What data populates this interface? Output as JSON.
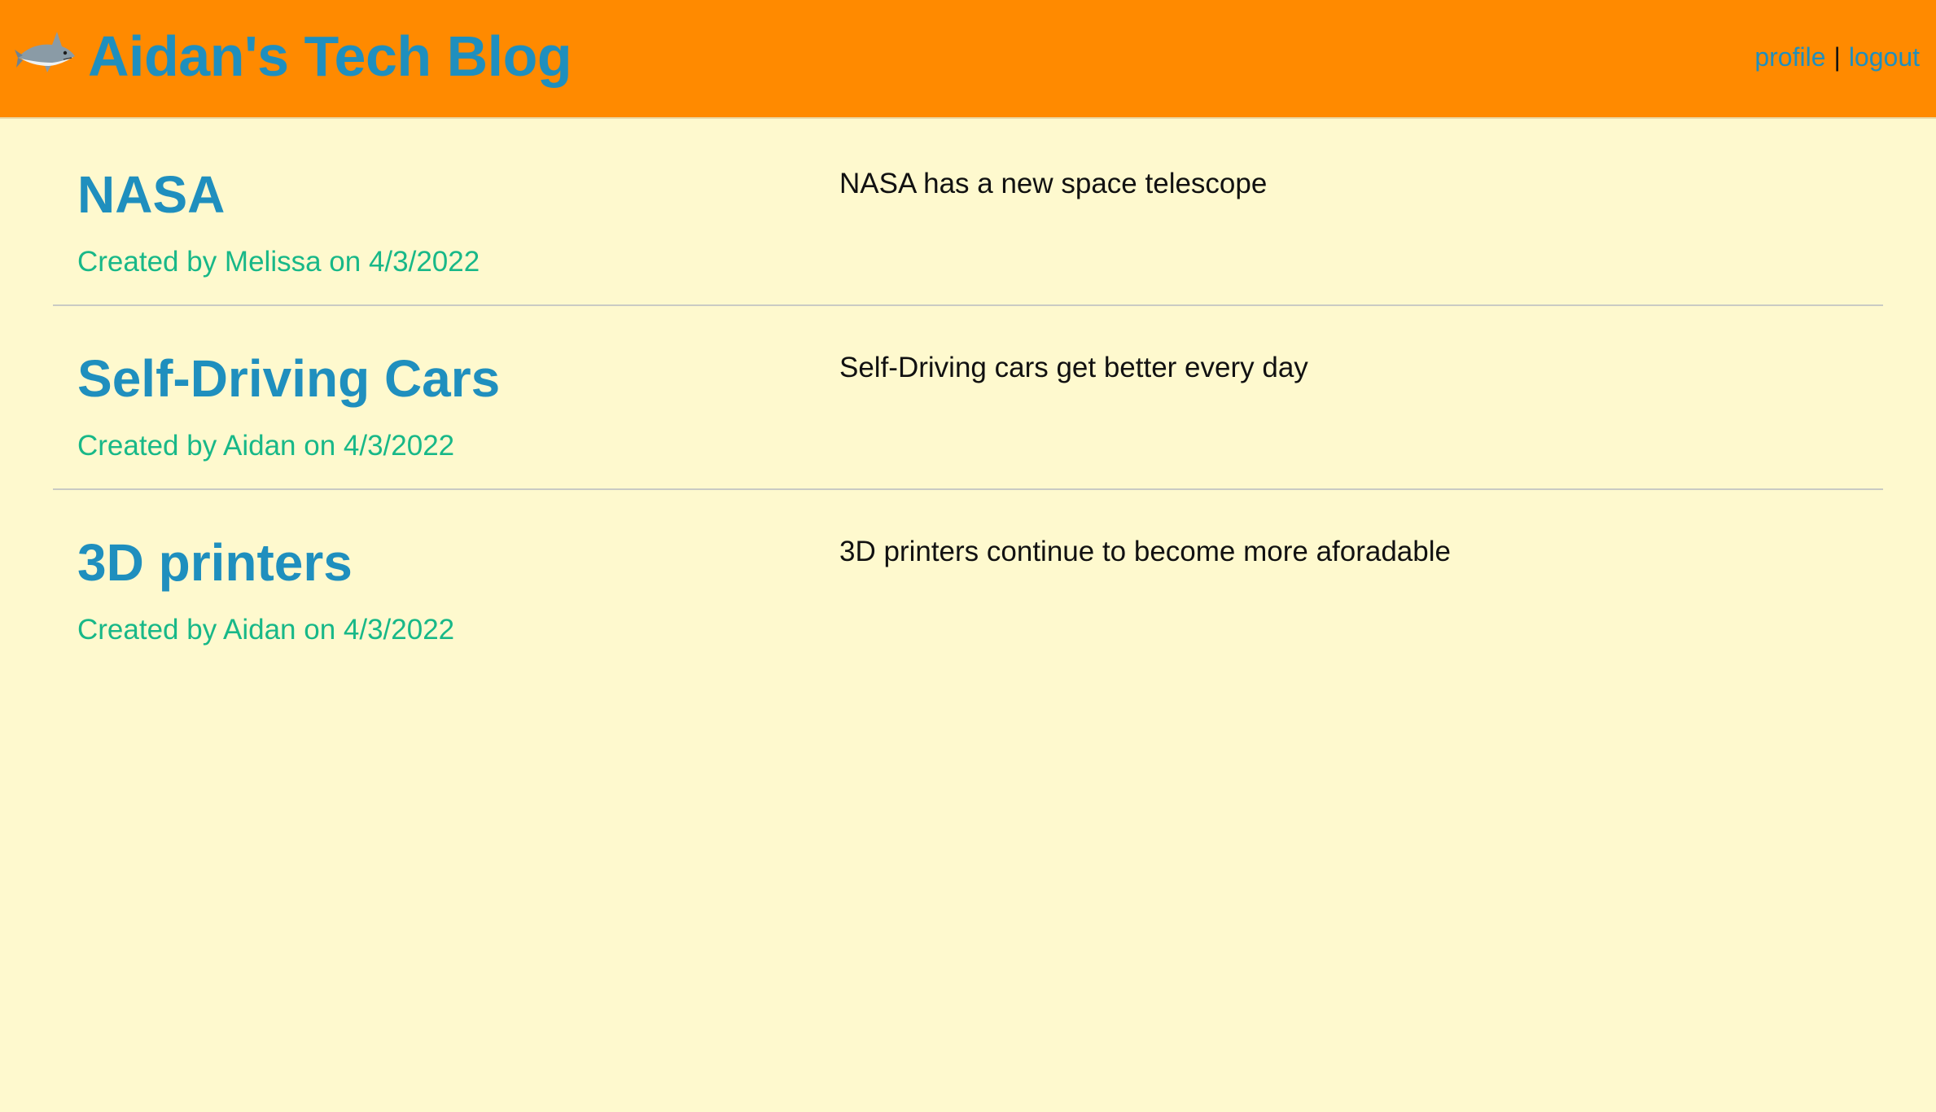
{
  "header": {
    "title": "Aidan's Tech Blog",
    "icon": "shark-icon",
    "nav": {
      "profile_label": "profile",
      "separator": "|",
      "logout_label": "logout"
    },
    "background_color": "#ff8a00",
    "link_color": "#1f8fbe"
  },
  "posts": [
    {
      "title": "NASA",
      "meta": "Created by Melissa on 4/3/2022",
      "body": "NASA has a new space telescope"
    },
    {
      "title": "Self-Driving Cars",
      "meta": "Created by Aidan on 4/3/2022",
      "body": "Self-Driving cars get better every day"
    },
    {
      "title": "3D printers",
      "meta": "Created by Aidan on 4/3/2022",
      "body": "3D printers continue to become more aforadable"
    }
  ],
  "colors": {
    "page_background": "#fef9ce",
    "meta_text": "#18b888"
  }
}
